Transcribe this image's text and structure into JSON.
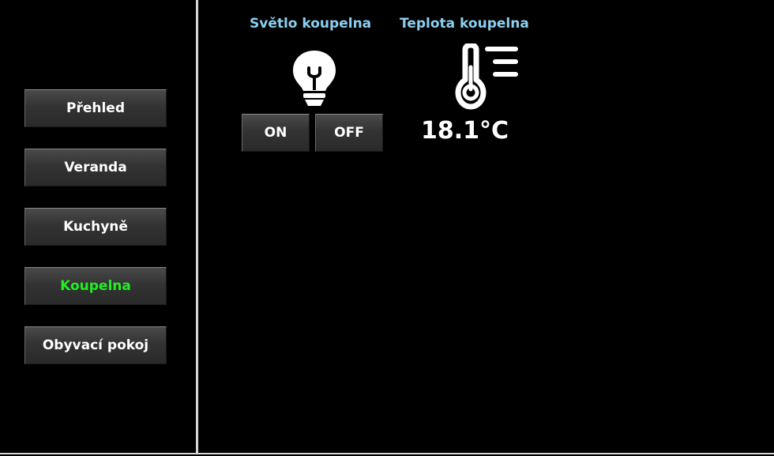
{
  "nav": {
    "items": [
      {
        "label": "Přehled",
        "active": false
      },
      {
        "label": "Veranda",
        "active": false
      },
      {
        "label": "Kuchyně",
        "active": false
      },
      {
        "label": "Koupelna",
        "active": true
      },
      {
        "label": "Obyvací pokoj",
        "active": false
      }
    ]
  },
  "light_widget": {
    "title": "Světlo koupelna",
    "icon": "lightbulb-icon",
    "on_label": "ON",
    "off_label": "OFF"
  },
  "temp_widget": {
    "title": "Teplota koupelna",
    "icon": "thermometer-icon",
    "value": "18.1°C"
  },
  "colors": {
    "background": "#000000",
    "active_nav": "#22ee22",
    "widget_title": "#8ccff0",
    "text": "#ffffff"
  }
}
